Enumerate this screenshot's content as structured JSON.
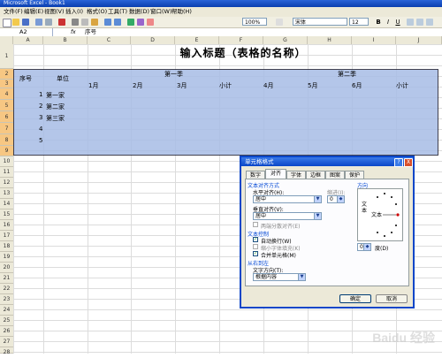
{
  "window": {
    "title": "Microsoft Excel - Book1"
  },
  "menu": [
    "文件(F)",
    "编辑(E)",
    "视图(V)",
    "插入(I)",
    "格式(O)",
    "工具(T)",
    "数据(D)",
    "窗口(W)",
    "帮助(H)"
  ],
  "toolbar": {
    "zoom": "100%",
    "font_name": "宋体",
    "font_size": "12"
  },
  "formula_bar": {
    "cell_ref": "A2",
    "fx": "fx",
    "content": "序号"
  },
  "columns": [
    "A",
    "B",
    "C",
    "D",
    "E",
    "F",
    "G",
    "H",
    "I",
    "J"
  ],
  "rows": [
    "1",
    "2",
    "3",
    "4",
    "5",
    "6",
    "7",
    "8",
    "9",
    "10",
    "11",
    "12",
    "13",
    "14",
    "15",
    "16",
    "17",
    "18",
    "19",
    "20",
    "21",
    "22",
    "23",
    "24",
    "25",
    "26",
    "27",
    "28"
  ],
  "sheet": {
    "title": "输入标题（表格的名称）",
    "header_no": "序号",
    "header_unit": "单位",
    "q1": "第一季",
    "q2": "第二季",
    "months": [
      "1月",
      "2月",
      "3月",
      "小计",
      "4月",
      "5月",
      "6月",
      "小计"
    ],
    "row_numbers": [
      "1",
      "2",
      "3",
      "4",
      "5"
    ],
    "units": [
      "第一家",
      "第二家",
      "第三家"
    ]
  },
  "dialog": {
    "title": "单元格格式",
    "help": "?",
    "close": "X",
    "tabs": [
      "数字",
      "对齐",
      "字体",
      "边框",
      "图案",
      "保护"
    ],
    "active_tab": "对齐",
    "text_align_section": "文本对齐方式",
    "h_align_label": "水平对齐(H):",
    "h_align_value": "居中",
    "indent_label": "缩进(I):",
    "indent_value": "0",
    "v_align_label": "垂直对齐(V):",
    "v_align_value": "居中",
    "justify_distributed": "两端分散对齐(E)",
    "text_control_section": "文本控制",
    "wrap_text": "自动换行(W)",
    "shrink_to_fit": "缩小字体填充(K)",
    "merge_cells": "合并单元格(M)",
    "rtl_section": "从右到左",
    "text_direction_label": "文字方向(T):",
    "text_direction_value": "根据内容",
    "orientation_section": "方向",
    "orientation_vertical": "文本",
    "orientation_text": "文本",
    "degree_value": "0",
    "degree_label": "度(D)",
    "ok": "确定",
    "cancel": "取消"
  },
  "watermark": "Baidu 经验"
}
